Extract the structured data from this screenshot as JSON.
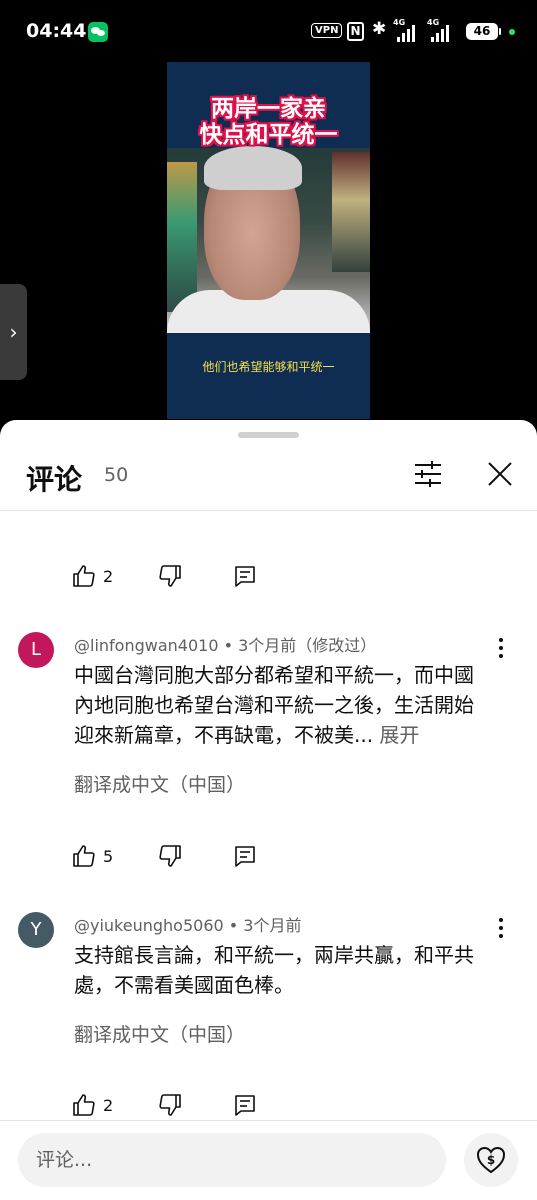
{
  "status_bar": {
    "time": "04:44",
    "vpn": "VPN",
    "signal1_label": "4G",
    "signal2_label": "4G",
    "battery": "46"
  },
  "video": {
    "title_line1": "两岸一家亲",
    "title_line2": "快点和平统一",
    "subtitle": "他们也希望能够和平统一"
  },
  "comments_panel": {
    "title": "评论",
    "count": "50",
    "top_action": {
      "likes": "2"
    },
    "comments": [
      {
        "avatar_letter": "L",
        "avatar_color": "#c2185b",
        "meta": "@linfongwan4010 • 3个月前（修改过）",
        "body": "中國台灣同胞大部分都希望和平統一，而中國內地同胞也希望台灣和平統一之後，生活開始迎來新篇章，不再缺電，不被美...",
        "expand": " 展开",
        "translate": "翻译成中文（中国）",
        "likes": "5"
      },
      {
        "avatar_letter": "Y",
        "avatar_color": "#455a64",
        "meta": "@yiukeungho5060 • 3个月前",
        "body": "支持館長言論，和平統一，兩岸共贏，和平共處，不需看美國面色棒。",
        "translate": "翻译成中文（中国）",
        "likes": "2"
      }
    ],
    "input_placeholder": "评论..."
  }
}
